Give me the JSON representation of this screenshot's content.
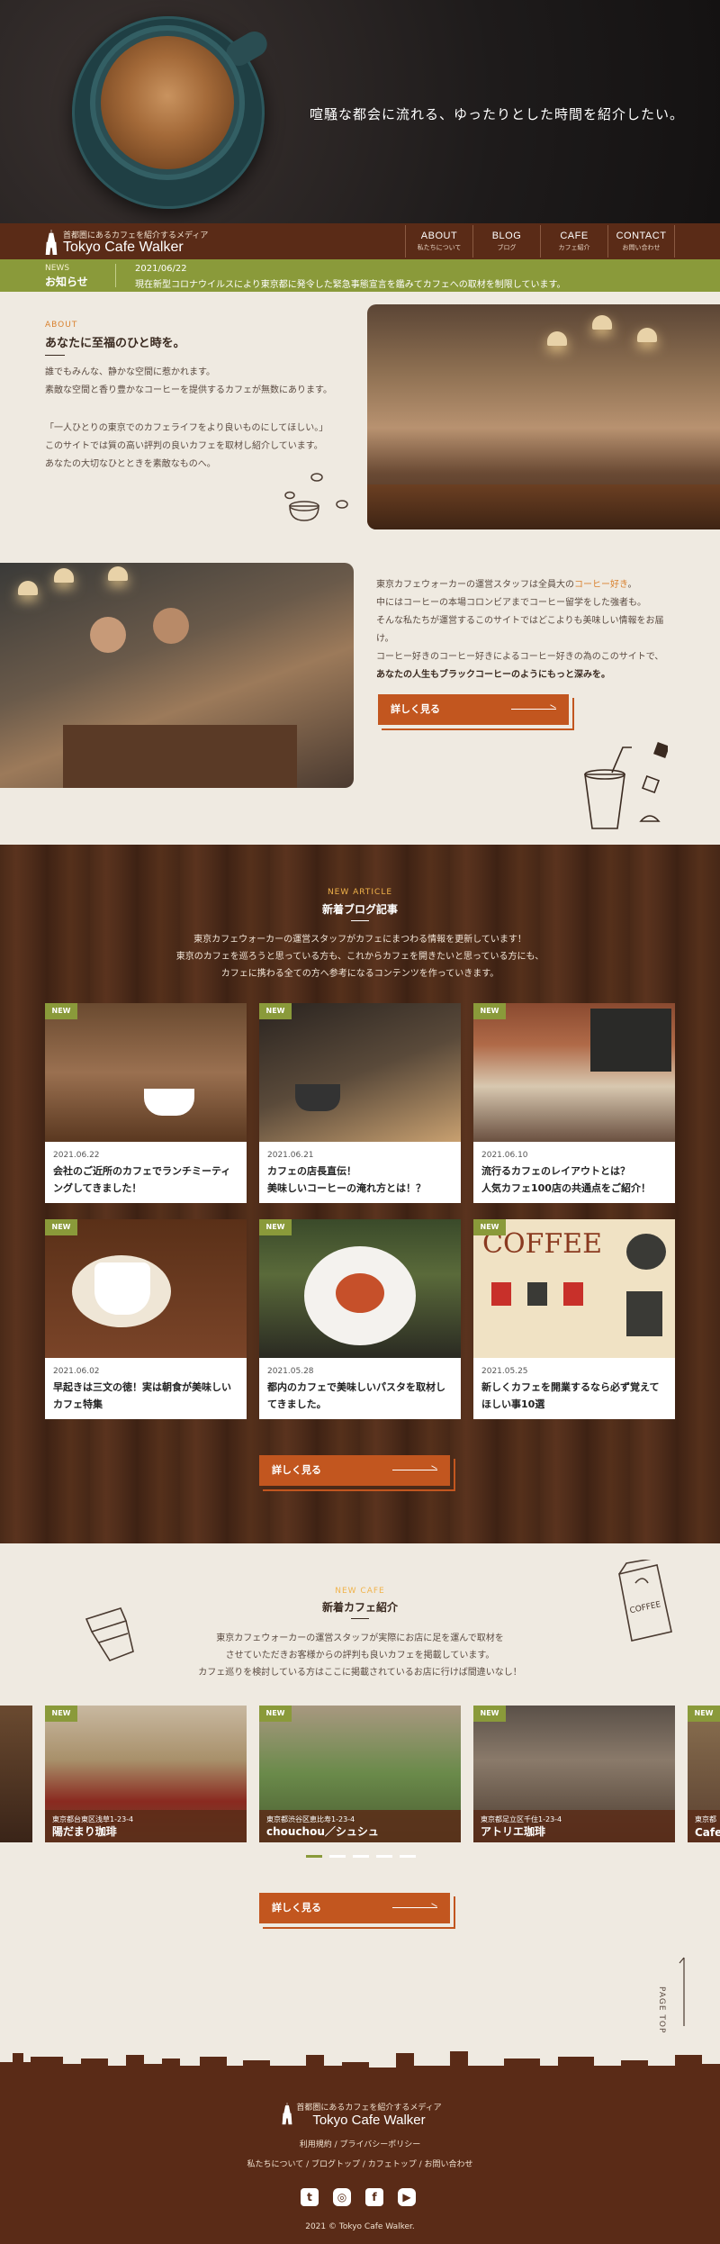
{
  "hero": {
    "tagline": "喧騒な都会に流れる、ゆったりとした時間を紹介したい。"
  },
  "header": {
    "logo_sub": "首都圏にあるカフェを紹介するメディア",
    "logo": "Tokyo Cafe Walker",
    "nav": [
      {
        "en": "ABOUT",
        "jp": "私たちについて"
      },
      {
        "en": "BLOG",
        "jp": "ブログ"
      },
      {
        "en": "CAFE",
        "jp": "カフェ紹介"
      },
      {
        "en": "CONTACT",
        "jp": "お問い合わせ"
      }
    ]
  },
  "news": {
    "en": "NEWS",
    "jp": "お知らせ",
    "date": "2021/06/22",
    "text": "現在新型コロナウイルスにより東京都に発令した緊急事態宣言を鑑みてカフェへの取材を制限しています。"
  },
  "about": {
    "en": "ABOUT",
    "title": "あなたに至福のひと時を。",
    "p1": [
      "誰でもみんな、静かな空間に惹かれます。",
      "素敵な空間と香り豊かなコーヒーを提供するカフェが無数にあります。"
    ],
    "p2": [
      "「一人ひとりの東京でのカフェライフをより良いものにしてほしい。」",
      "このサイトでは質の高い評判の良いカフェを取材し紹介しています。",
      "あなたの大切なひとときを素敵なものへ。"
    ]
  },
  "intro": {
    "line1_a": "東京カフェウォーカーの運営スタッフは全員大の",
    "line1_hl": "コーヒー好き",
    "line1_b": "。",
    "line2": "中にはコーヒーの本場コロンビアまでコーヒー留学をした強者も。",
    "line3": "そんな私たちが運営するこのサイトではどこよりも美味しい情報をお届け。",
    "line4": "コーヒー好きのコーヒー好きによるコーヒー好きの為のこのサイトで、",
    "line5": "あなたの人生もブラックコーヒーのようにもっと深みを。",
    "button": "詳しく見る"
  },
  "blog": {
    "en": "NEW ARTICLE",
    "title": "新着ブログ記事",
    "p": [
      "東京カフェウォーカーの運営スタッフがカフェにまつわる情報を更新しています！",
      "東京のカフェを巡ろうと思っている方も、これからカフェを開きたいと思っている方にも、",
      "カフェに携わる全ての方へ参考になるコンテンツを作っていきます。"
    ],
    "badge": "NEW",
    "cards": [
      {
        "date": "2021.06.22",
        "title": "会社のご近所のカフェでランチミーティングしてきました！"
      },
      {
        "date": "2021.06.21",
        "title": "カフェの店長直伝！\n美味しいコーヒーの淹れ方とは！？"
      },
      {
        "date": "2021.06.10",
        "title": "流行るカフェのレイアウトとは？\n人気カフェ100店の共通点をご紹介！"
      },
      {
        "date": "2021.06.02",
        "title": "早起きは三文の徳！実は朝食が美味しいカフェ特集"
      },
      {
        "date": "2021.05.28",
        "title": "都内のカフェで美味しいパスタを取材してきました。"
      },
      {
        "date": "2021.05.25",
        "title": "新しくカフェを開業するなら必ず覚えてほしい事10選"
      }
    ],
    "button": "詳しく見る"
  },
  "cafes": {
    "en": "NEW CAFE",
    "title": "新着カフェ紹介",
    "p": [
      "東京カフェウォーカーの運営スタッフが実際にお店に足を運んで取材を",
      "させていただきお客様からの評判も良いカフェを掲載しています。",
      "カフェ巡りを検討している方はここに掲載されているお店に行けば間違いなし！"
    ],
    "badge": "NEW",
    "shops": [
      {
        "addr": "東京都台東区浅草1-23-4",
        "name": "陽だまり珈琲"
      },
      {
        "addr": "東京都渋谷区恵比寿1-23-4",
        "name": "chouchou／シュシュ"
      },
      {
        "addr": "東京都足立区千住1-23-4",
        "name": "アトリエ珈琲"
      }
    ],
    "edge_addr": "東京都",
    "edge_name": "Cafe",
    "button": "詳しく見る"
  },
  "coffee_icon_label": "COFFEE",
  "pagetop": "PAGE TOP",
  "footer": {
    "logo_sub": "首都圏にあるカフェを紹介するメディア",
    "logo": "Tokyo Cafe Walker",
    "links1": "利用規約 / プライバシーポリシー",
    "links2": "私たちについて / ブログトップ / カフェトップ / お問い合わせ",
    "copyright": "2021 © Tokyo Cafe Walker."
  },
  "colors": {
    "brown": "#5a2b17",
    "olive": "#8a9a3a",
    "orange": "#c2561f",
    "accent": "#d9812e"
  },
  "icons": [
    "tokyo-tower-icon",
    "coffee-beans-icon",
    "iced-drink-icon",
    "tumbler-icon",
    "coffee-bag-icon",
    "twitter-icon",
    "instagram-icon",
    "facebook-icon",
    "youtube-icon"
  ]
}
